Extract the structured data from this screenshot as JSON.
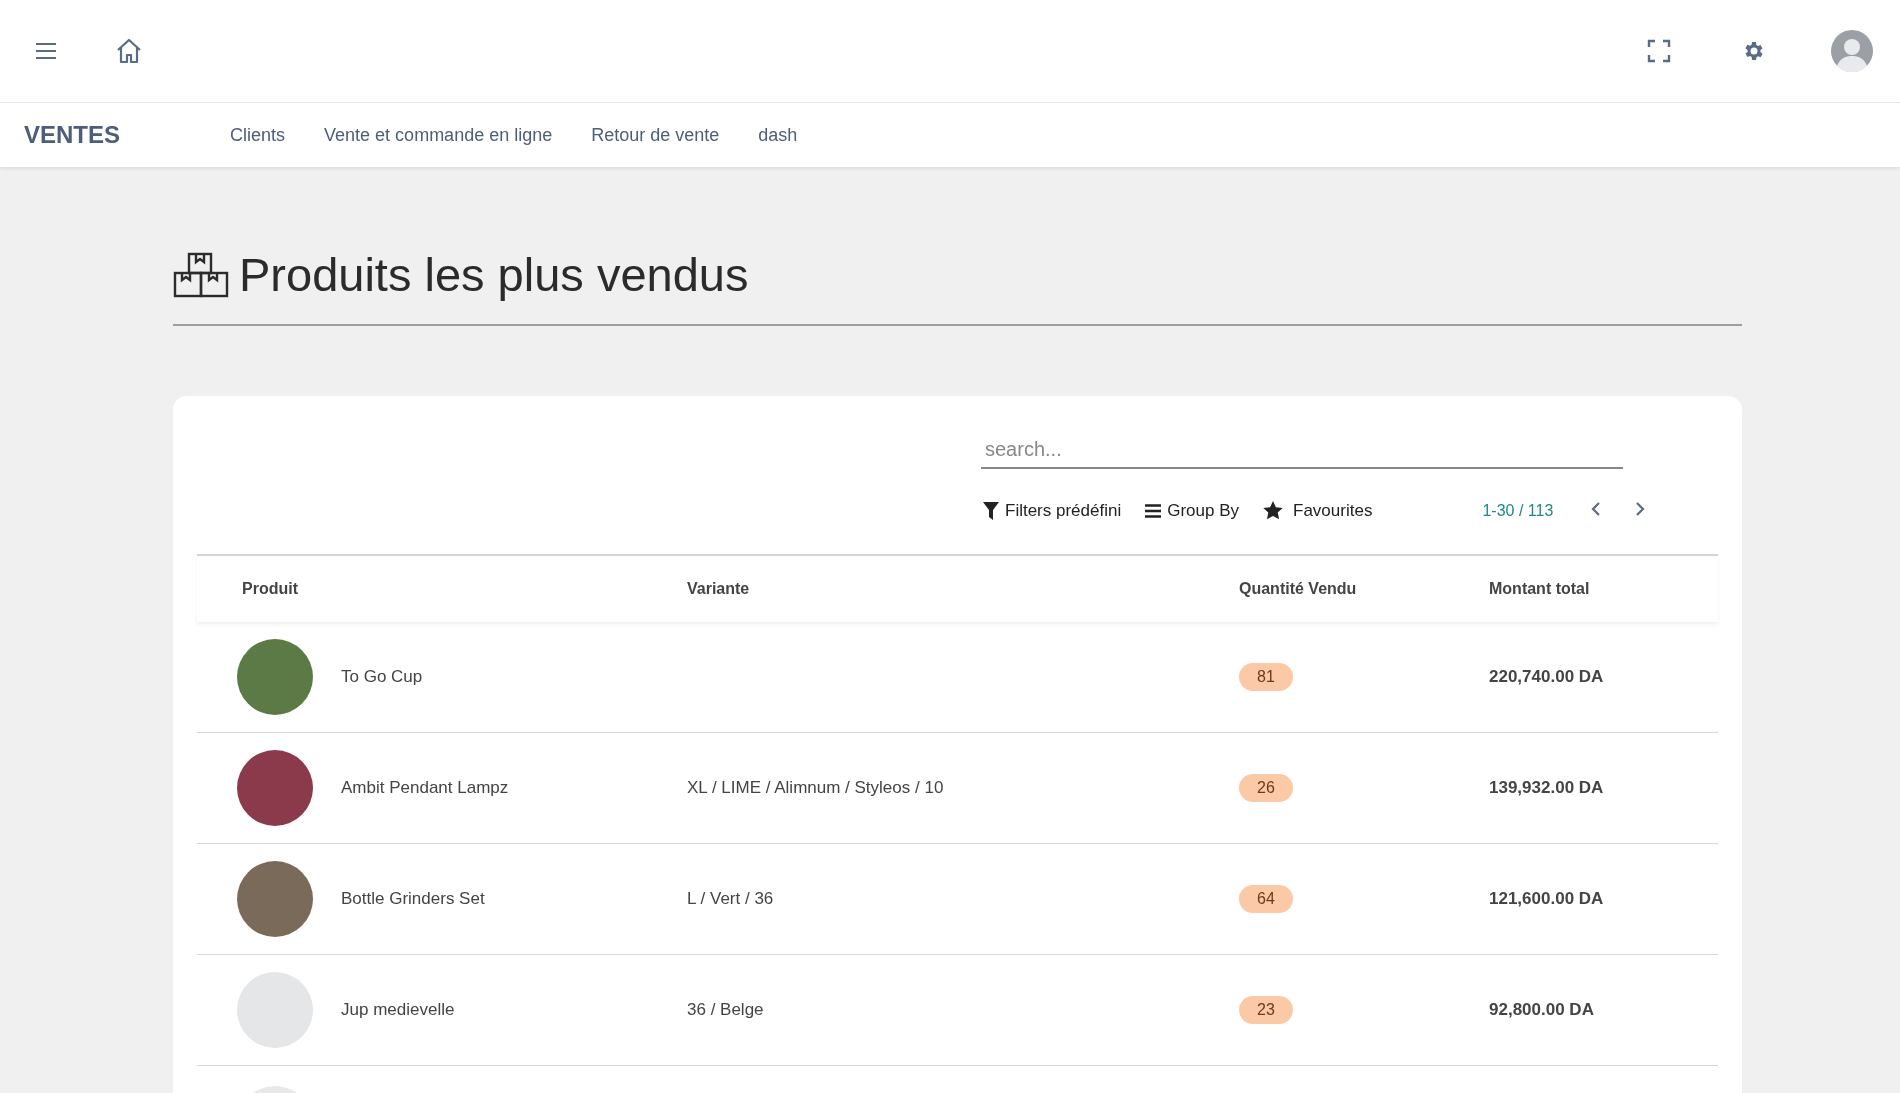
{
  "topbar": {
    "app_title": "VENTES",
    "nav": [
      "Clients",
      "Vente et commande en ligne",
      "Retour de vente",
      "dash"
    ]
  },
  "page": {
    "title": "Produits les plus vendus"
  },
  "search": {
    "placeholder": "search..."
  },
  "toolbar": {
    "filters": "Filters prédéfini",
    "group_by": "Group By",
    "favourites": "Favourites",
    "pager": "1-30 / 113"
  },
  "table": {
    "columns": [
      "Produit",
      "Variante",
      "Quantité Vendu",
      "Montant total"
    ],
    "rows": [
      {
        "product": "To Go Cup",
        "quantity": "81",
        "amount": "220,740.00 DA"
      },
      {
        "product": "Ambit Pendant Lampz",
        "variant": "XL / LIME / Alimnum / Styleos / 10",
        "quantity": "26",
        "amount": "139,932.00 DA"
      },
      {
        "product": "Bottle Grinders Set",
        "variant": "L / Vert / 36",
        "quantity": "64",
        "amount": "121,600.00 DA"
      },
      {
        "product": "Jup medievelle",
        "variant": "36 / Belge",
        "quantity": "23",
        "amount": "92,800.00 DA"
      }
    ]
  }
}
